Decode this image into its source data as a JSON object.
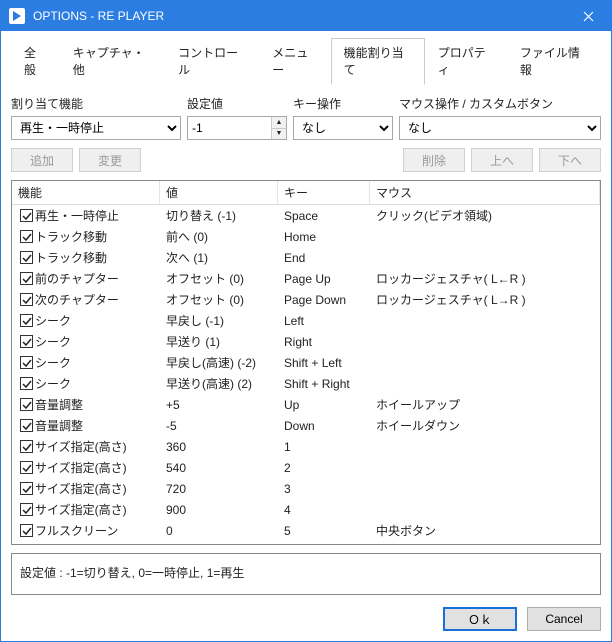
{
  "window": {
    "title": "OPTIONS - RE PLAYER"
  },
  "tabs": {
    "items": [
      "全般",
      "キャプチャ・他",
      "コントロール",
      "メニュー",
      "機能割り当て",
      "プロパティ",
      "ファイル情報"
    ],
    "active": 4
  },
  "labels": {
    "func": "割り当て機能",
    "value": "設定値",
    "key": "キー操作",
    "mouse": "マウス操作 / カスタムボタン"
  },
  "inputs": {
    "func_selected": "再生・一時停止",
    "value": "-1",
    "key_selected": "なし",
    "mouse_selected": "なし"
  },
  "buttons": {
    "add": "追加",
    "change": "変更",
    "delete": "削除",
    "up": "上へ",
    "down": "下へ",
    "ok": "Ｏｋ",
    "cancel": "Cancel"
  },
  "columns": {
    "c1": "機能",
    "c2": "値",
    "c3": "キー",
    "c4": "マウス"
  },
  "rows": [
    {
      "f": "再生・一時停止",
      "v": "切り替え (-1)",
      "k": "Space",
      "m": "クリック(ビデオ領域)"
    },
    {
      "f": "トラック移動",
      "v": "前へ (0)",
      "k": "Home",
      "m": ""
    },
    {
      "f": "トラック移動",
      "v": "次へ (1)",
      "k": "End",
      "m": ""
    },
    {
      "f": "前のチャプター",
      "v": "オフセット (0)",
      "k": "Page Up",
      "m": "ロッカージェスチャ( L←R )"
    },
    {
      "f": "次のチャプター",
      "v": "オフセット (0)",
      "k": "Page Down",
      "m": "ロッカージェスチャ( L→R )"
    },
    {
      "f": "シーク",
      "v": "早戻し (-1)",
      "k": "Left",
      "m": ""
    },
    {
      "f": "シーク",
      "v": "早送り (1)",
      "k": "Right",
      "m": ""
    },
    {
      "f": "シーク",
      "v": "早戻し(高速) (-2)",
      "k": "Shift + Left",
      "m": ""
    },
    {
      "f": "シーク",
      "v": "早送り(高速) (2)",
      "k": "Shift + Right",
      "m": ""
    },
    {
      "f": "音量調整",
      "v": "+5",
      "k": "Up",
      "m": "ホイールアップ"
    },
    {
      "f": "音量調整",
      "v": "-5",
      "k": "Down",
      "m": "ホイールダウン"
    },
    {
      "f": "サイズ指定(高さ)",
      "v": "360",
      "k": "1",
      "m": ""
    },
    {
      "f": "サイズ指定(高さ)",
      "v": "540",
      "k": "2",
      "m": ""
    },
    {
      "f": "サイズ指定(高さ)",
      "v": "720",
      "k": "3",
      "m": ""
    },
    {
      "f": "サイズ指定(高さ)",
      "v": "900",
      "k": "4",
      "m": ""
    },
    {
      "f": "フルスクリーン",
      "v": "0",
      "k": "5",
      "m": "中央ボタン"
    }
  ],
  "help": "設定値 : -1=切り替え, 0=一時停止, 1=再生"
}
